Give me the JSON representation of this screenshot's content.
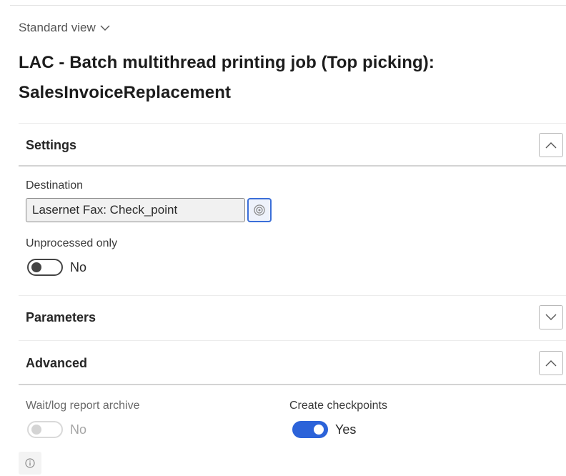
{
  "view": {
    "label": "Standard view"
  },
  "page": {
    "title_line1": "LAC - Batch multithread printing job (Top picking):",
    "title_line2": "SalesInvoiceReplacement"
  },
  "sections": {
    "settings": {
      "title": "Settings",
      "state": "expanded",
      "destination": {
        "label": "Destination",
        "value": "Lasernet Fax: Check_point"
      },
      "unprocessed_only": {
        "label": "Unprocessed only",
        "value": "No",
        "on": false
      }
    },
    "parameters": {
      "title": "Parameters",
      "state": "collapsed"
    },
    "advanced": {
      "title": "Advanced",
      "state": "expanded",
      "wait_log": {
        "label": "Wait/log report archive",
        "value": "No",
        "on": false,
        "disabled": true
      },
      "create_checkpoints": {
        "label": "Create checkpoints",
        "value": "Yes",
        "on": true
      }
    }
  },
  "icons": {
    "view_chevron": "chevron-down-icon",
    "collapse": "chevron-up-icon",
    "expand": "chevron-down-icon",
    "lookup": "lookup-gear-icon",
    "info": "info-icon"
  },
  "colors": {
    "accent": "#2c63d9",
    "lookup_border": "#3b6fd8"
  }
}
